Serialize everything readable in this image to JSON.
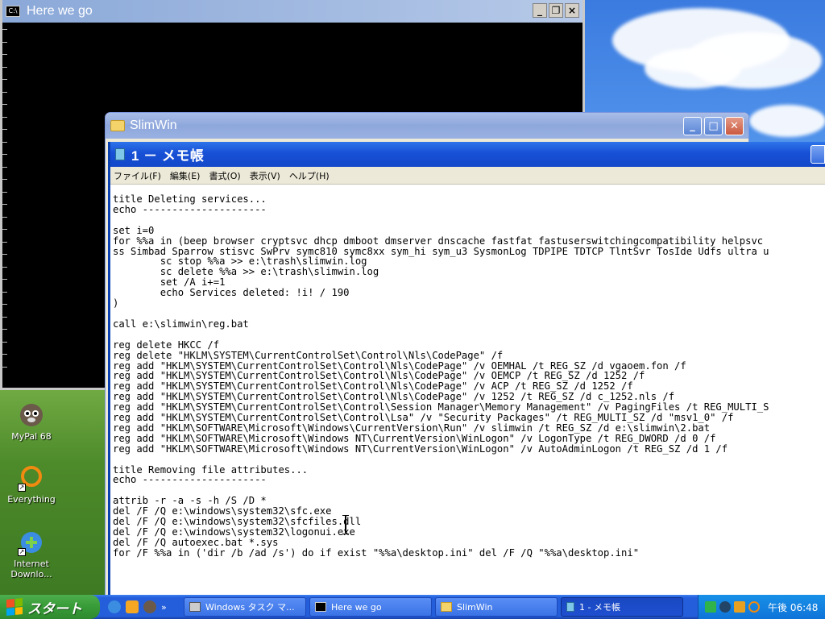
{
  "console": {
    "title": "Here we go",
    "icon": "C:\\"
  },
  "slimwin": {
    "title": "SlimWin"
  },
  "notepad": {
    "title": "1 － メモ帳",
    "menu": [
      "ファイル(F)",
      "編集(E)",
      "書式(O)",
      "表示(V)",
      "ヘルプ(H)"
    ],
    "content": "title Deleting services...\necho ---------------------\n\nset i=0\nfor %%a in (beep browser cryptsvc dhcp dmboot dmserver dnscache fastfat fastuserswitchingcompatibility helpsvc\nss Simbad Sparrow stisvc SwPrv symc810 symc8xx sym_hi sym_u3 SysmonLog TDPIPE TDTCP TlntSvr TosIde Udfs ultra u\n        sc stop %%a >> e:\\trash\\slimwin.log\n        sc delete %%a >> e:\\trash\\slimwin.log\n        set /A i+=1\n        echo Services deleted: !i! / 190\n)\n\ncall e:\\slimwin\\reg.bat\n\nreg delete HKCC /f\nreg delete \"HKLM\\SYSTEM\\CurrentControlSet\\Control\\Nls\\CodePage\" /f\nreg add \"HKLM\\SYSTEM\\CurrentControlSet\\Control\\Nls\\CodePage\" /v OEMHAL /t REG_SZ /d vgaoem.fon /f\nreg add \"HKLM\\SYSTEM\\CurrentControlSet\\Control\\Nls\\CodePage\" /v OEMCP /t REG_SZ /d 1252 /f\nreg add \"HKLM\\SYSTEM\\CurrentControlSet\\Control\\Nls\\CodePage\" /v ACP /t REG_SZ /d 1252 /f\nreg add \"HKLM\\SYSTEM\\CurrentControlSet\\Control\\Nls\\CodePage\" /v 1252 /t REG_SZ /d c_1252.nls /f\nreg add \"HKLM\\SYSTEM\\CurrentControlSet\\Control\\Session Manager\\Memory Management\" /v PagingFiles /t REG_MULTI_S\nreg add \"HKLM\\SYSTEM\\CurrentControlSet\\Control\\Lsa\" /v \"Security Packages\" /t REG_MULTI_SZ /d \"msv1_0\" /f\nreg add \"HKLM\\SOFTWARE\\Microsoft\\Windows\\CurrentVersion\\Run\" /v slimwin /t REG_SZ /d e:\\slimwin\\2.bat\nreg add \"HKLM\\SOFTWARE\\Microsoft\\Windows NT\\CurrentVersion\\WinLogon\" /v LogonType /t REG_DWORD /d 0 /f\nreg add \"HKLM\\SOFTWARE\\Microsoft\\Windows NT\\CurrentVersion\\WinLogon\" /v AutoAdminLogon /t REG_SZ /d 1 /f\n\ntitle Removing file attributes...\necho ---------------------\n\nattrib -r -a -s -h /S /D *\ndel /F /Q e:\\windows\\system32\\sfc.exe\ndel /F /Q e:\\windows\\system32\\sfcfiles.dll\ndel /F /Q e:\\windows\\system32\\logonui.exe\ndel /F /Q autoexec.bat *.sys\nfor /F %%a in ('dir /b /ad /s') do if exist \"%%a\\desktop.ini\" del /F /Q \"%%a\\desktop.ini\""
  },
  "desktop_icons": [
    {
      "label": "MyPal 68",
      "icon": "raccoon-icon"
    },
    {
      "label": "Everything",
      "icon": "everything-icon"
    },
    {
      "label": "Internet\nDownlo...",
      "icon": "download-icon"
    }
  ],
  "taskbar": {
    "start_label": "スタート",
    "quick_launch_chevron": "»",
    "buttons": [
      {
        "label": "Windows タスク マ...",
        "icon": "task-manager-icon",
        "active": false
      },
      {
        "label": "Here we go",
        "icon": "cmd-icon",
        "active": false
      },
      {
        "label": "SlimWin",
        "icon": "folder-icon",
        "active": false
      },
      {
        "label": "1 - メモ帳",
        "icon": "notepad-icon",
        "active": true
      }
    ],
    "clock": "午後 06:48"
  },
  "colors": {
    "taskbar": "#245edb",
    "start": "#379b37",
    "notepad_title": "#1750d6",
    "tray": "#0f74d8"
  }
}
